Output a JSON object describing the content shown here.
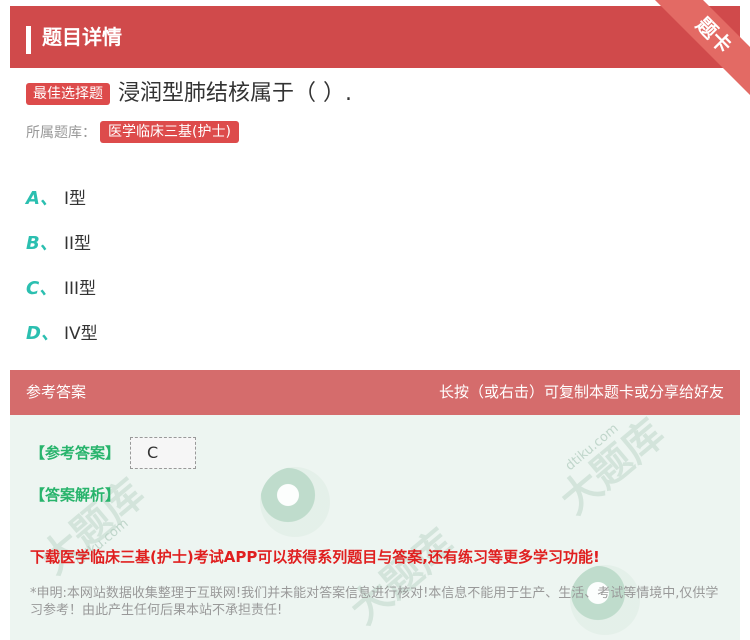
{
  "header": {
    "title": "题目详情",
    "corner_label": "题卡"
  },
  "question": {
    "type_badge": "最佳选择题",
    "text": "浸润型肺结核属于（ ）.",
    "bank_label": "所属题库：",
    "bank_name": "医学临床三基(护士)"
  },
  "options": [
    {
      "letter": "A、",
      "text": "I型"
    },
    {
      "letter": "B、",
      "text": "II型"
    },
    {
      "letter": "C、",
      "text": "III型"
    },
    {
      "letter": "D、",
      "text": "IV型"
    }
  ],
  "answer_section": {
    "title": "参考答案",
    "hint": "长按（或右击）可复制本题卡或分享给好友",
    "answer_label": "【参考答案】",
    "answer_value": "C",
    "analysis_label": "【答案解析】",
    "promo": "下载医学临床三基(护士)考试APP可以获得系列题目与答案,还有练习等更多学习功能!",
    "disclaimer": "*申明:本网站数据收集整理于互联网!我们并未能对答案信息进行核对!本信息不能用于生产、生活、考试等情境中,仅供学习参考！由此产生任何后果本站不承担责任!"
  },
  "colors": {
    "header_bg": "#d04a4b",
    "badge_bg": "#dd4b4b",
    "option_letter": "#2bbfb0",
    "answer_header_bg": "#d56c6c",
    "answer_body_bg": "#edf5f1",
    "answer_label": "#28b46c",
    "promo": "#e01f1f"
  },
  "watermark": {
    "brand": "大题库",
    "domain": "dtiku.com"
  }
}
